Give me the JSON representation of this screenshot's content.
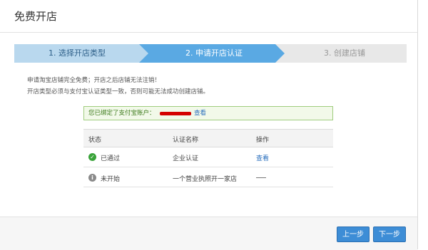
{
  "dialog": {
    "title": "免费开店"
  },
  "steps": [
    {
      "label": "1. 选择开店类型"
    },
    {
      "label": "2. 申请开店认证"
    },
    {
      "label": "3. 创建店铺"
    }
  ],
  "notice": {
    "line1": "申请淘宝店铺完全免费；开店之后店铺无法注销！",
    "line2": "开店类型必须与支付宝认证类型一致，否则可能无法成功创建店铺。"
  },
  "binding": {
    "text": "您已绑定了支付宝账户：",
    "link": "查看"
  },
  "table": {
    "headers": [
      "状态",
      "认证名称",
      "操作"
    ],
    "rows": [
      {
        "status": "已通过",
        "status_icon": "check-circle-icon",
        "name": "企业认证",
        "action": "查看"
      },
      {
        "status": "未开始",
        "status_icon": "info-circle-icon",
        "name": "一个营业执照开一家店",
        "action": ""
      }
    ]
  },
  "buttons": {
    "prev": "上一步",
    "next": "下一步"
  },
  "colors": {
    "step_done": "#b9d8ee",
    "step_active": "#5aa9e3",
    "button": "#3d8dd6",
    "success": "#3aa33a"
  }
}
